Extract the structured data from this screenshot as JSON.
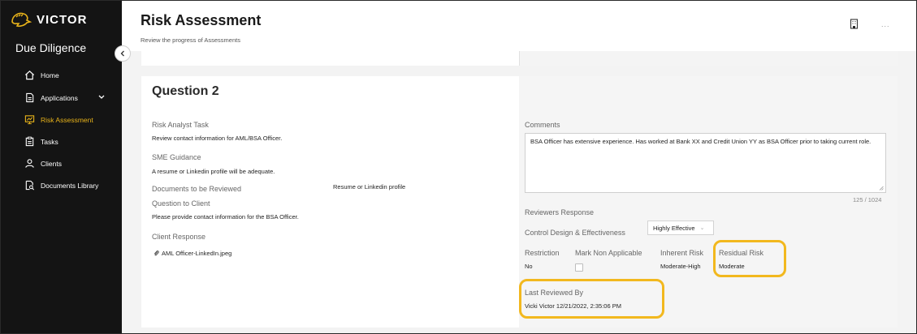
{
  "brand": {
    "name": "VICTOR",
    "app_name": "Due Diligence"
  },
  "sidebar": {
    "items": [
      {
        "label": "Home",
        "icon": "home-icon"
      },
      {
        "label": "Applications",
        "icon": "document-icon"
      },
      {
        "label": "Risk Assessment",
        "icon": "risk-chart-icon"
      },
      {
        "label": "Tasks",
        "icon": "clipboard-icon"
      },
      {
        "label": "Clients",
        "icon": "user-icon"
      },
      {
        "label": "Documents Library",
        "icon": "document-search-icon"
      }
    ],
    "active_color": "#e8b31a"
  },
  "header": {
    "title": "Risk Assessment",
    "subtitle": "Review the progress of Assessments",
    "more_label": "..."
  },
  "question": {
    "title": "Question 2",
    "risk_analyst_task_label": "Risk Analyst Task",
    "risk_analyst_task": "Review contact information for AML/BSA Officer.",
    "sme_guidance_label": "SME Guidance",
    "sme_guidance": "A resume or Linkedin profile will be adequate.",
    "documents_label": "Documents to be Reviewed",
    "documents": "Resume or Linkedin profile",
    "question_to_client_label": "Question to Client",
    "question_to_client": "Please provide contact information for the BSA Officer.",
    "client_response_label": "Client Response",
    "attachment": "AML Officer-LinkedIn.jpeg"
  },
  "review": {
    "comments_label": "Comments",
    "comments": "BSA Officer has extensive experience. Has worked at Bank XX and Credit Union YY as BSA Officer prior to taking current role.",
    "counter": "125 / 1024",
    "reviewers_response_label": "Reviewers Response",
    "control_label": "Control Design & Effectiveness",
    "control_value": "Highly Effective",
    "restriction_label": "Restriction",
    "restriction_value": "No",
    "mark_na_label": "Mark Non Applicable",
    "mark_na_checked": false,
    "inherent_risk_label": "Inherent Risk",
    "inherent_risk_value": "Moderate-High",
    "residual_risk_label": "Residual Risk",
    "residual_risk_value": "Moderate",
    "last_reviewed_label": "Last Reviewed By",
    "last_reviewed_value": "Vicki Victor 12/21/2022, 2:35:06 PM"
  },
  "highlight_color": "#f2b81e"
}
